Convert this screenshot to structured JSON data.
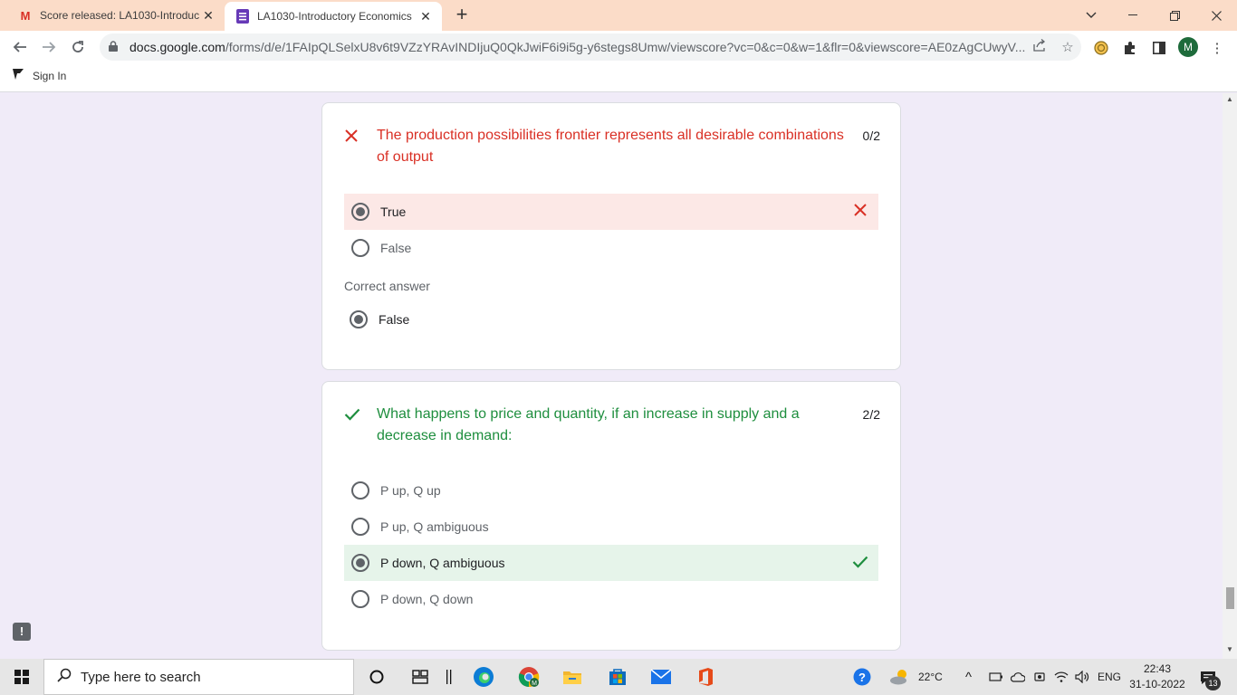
{
  "browser": {
    "tabs": [
      {
        "title": "Score released: LA1030-Introduct",
        "favicon": "gmail-icon",
        "active": false
      },
      {
        "title": "LA1030-Introductory Economics",
        "favicon": "google-forms-icon",
        "active": true
      }
    ],
    "url_host": "docs.google.com",
    "url_path": "/forms/d/e/1FAIpQLSelxU8v6t9VZzYRAvINDIjuQ0QkJwiF6i9i5g-y6stegs8Umw/viewscore?vc=0&c=0&w=1&flr=0&viewscore=AE0zAgCUwyV...",
    "profile_initial": "M",
    "bookmark_label": "Sign In"
  },
  "form": {
    "q1": {
      "text": "The production possibilities frontier represents all desirable combinations of output",
      "score": "0/2",
      "result": "incorrect",
      "options": [
        {
          "label": "True",
          "selected": true,
          "status": "wrong"
        },
        {
          "label": "False",
          "selected": false,
          "status": ""
        }
      ],
      "correct_answer_label": "Correct answer",
      "correct_answer": "False"
    },
    "q2": {
      "text": "What happens to price and quantity, if an increase in supply and a decrease in demand:",
      "score": "2/2",
      "result": "correct",
      "options": [
        {
          "label": "P up, Q up",
          "selected": false,
          "status": ""
        },
        {
          "label": "P up, Q ambiguous",
          "selected": false,
          "status": ""
        },
        {
          "label": "P down, Q ambiguous",
          "selected": true,
          "status": "right"
        },
        {
          "label": "P down, Q down",
          "selected": false,
          "status": ""
        }
      ]
    }
  },
  "colors": {
    "incorrect": "#d93025",
    "correct": "#1e8e3e",
    "page_bg": "#f0ebf8",
    "tab_strip": "#fbdcc8"
  },
  "taskbar": {
    "search_placeholder": "Type here to search",
    "temperature": "22°C",
    "language": "ENG",
    "time": "22:43",
    "date": "31-10-2022",
    "notifications": "13"
  }
}
